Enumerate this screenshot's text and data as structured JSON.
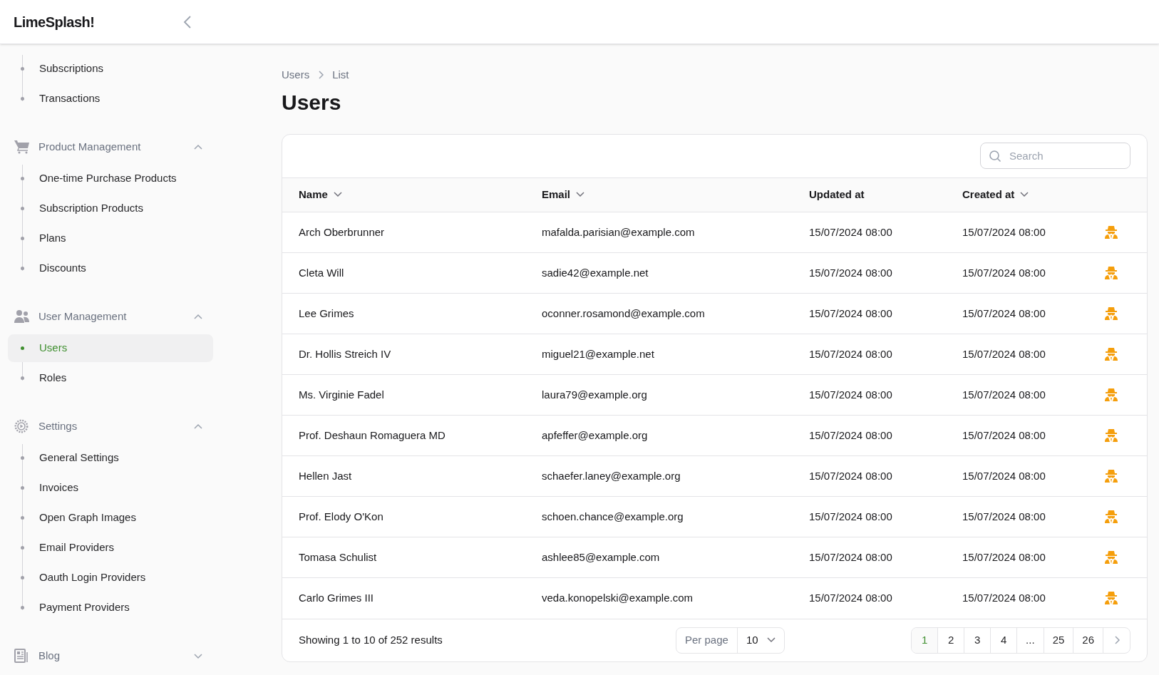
{
  "app": {
    "title": "LimeSplash!"
  },
  "sidebar": {
    "groups": [
      {
        "items": [
          {
            "label": "Subscriptions",
            "selected": false
          },
          {
            "label": "Transactions",
            "selected": false
          }
        ]
      },
      {
        "label": "Product Management",
        "kind": "cart",
        "expanded": true,
        "items": [
          {
            "label": "One-time Purchase Products",
            "selected": false
          },
          {
            "label": "Subscription Products",
            "selected": false
          },
          {
            "label": "Plans",
            "selected": false
          },
          {
            "label": "Discounts",
            "selected": false
          }
        ]
      },
      {
        "label": "User Management",
        "kind": "users",
        "expanded": true,
        "items": [
          {
            "label": "Users",
            "selected": true
          },
          {
            "label": "Roles",
            "selected": false
          }
        ]
      },
      {
        "label": "Settings",
        "kind": "gear",
        "expanded": true,
        "items": [
          {
            "label": "General Settings",
            "selected": false
          },
          {
            "label": "Invoices",
            "selected": false
          },
          {
            "label": "Open Graph Images",
            "selected": false
          },
          {
            "label": "Email Providers",
            "selected": false
          },
          {
            "label": "Oauth Login Providers",
            "selected": false
          },
          {
            "label": "Payment Providers",
            "selected": false
          }
        ]
      },
      {
        "label": "Blog",
        "kind": "news",
        "expanded": false
      }
    ]
  },
  "breadcrumb": [
    "Users",
    "List"
  ],
  "page_title": "Users",
  "search": {
    "placeholder": "Search"
  },
  "table": {
    "columns": [
      {
        "label": "Name",
        "sortable": true
      },
      {
        "label": "Email",
        "sortable": true
      },
      {
        "label": "Updated at",
        "sortable": false
      },
      {
        "label": "Created at",
        "sortable": true
      }
    ],
    "rows": [
      [
        "Arch Oberbrunner",
        "mafalda.parisian@example.com",
        "15/07/2024 08:00",
        "15/07/2024 08:00"
      ],
      [
        "Cleta Will",
        "sadie42@example.net",
        "15/07/2024 08:00",
        "15/07/2024 08:00"
      ],
      [
        "Lee Grimes",
        "oconner.rosamond@example.com",
        "15/07/2024 08:00",
        "15/07/2024 08:00"
      ],
      [
        "Dr. Hollis Streich IV",
        "miguel21@example.net",
        "15/07/2024 08:00",
        "15/07/2024 08:00"
      ],
      [
        "Ms. Virginie Fadel",
        "laura79@example.org",
        "15/07/2024 08:00",
        "15/07/2024 08:00"
      ],
      [
        "Prof. Deshaun Romaguera MD",
        "apfeffer@example.org",
        "15/07/2024 08:00",
        "15/07/2024 08:00"
      ],
      [
        "Hellen Jast",
        "schaefer.laney@example.org",
        "15/07/2024 08:00",
        "15/07/2024 08:00"
      ],
      [
        "Prof. Elody O'Kon",
        "schoen.chance@example.org",
        "15/07/2024 08:00",
        "15/07/2024 08:00"
      ],
      [
        "Tomasa Schulist",
        "ashlee85@example.com",
        "15/07/2024 08:00",
        "15/07/2024 08:00"
      ],
      [
        "Carlo Grimes III",
        "veda.konopelski@example.com",
        "15/07/2024 08:00",
        "15/07/2024 08:00"
      ]
    ]
  },
  "footer": {
    "summary": "Showing 1 to 10 of 252 results",
    "per_page_label": "Per page",
    "per_page_value": "10",
    "pages": [
      {
        "label": "1",
        "selected": true
      },
      {
        "label": "2",
        "selected": false
      },
      {
        "label": "3",
        "selected": false
      },
      {
        "label": "4",
        "selected": false
      },
      {
        "label": "...",
        "selected": false
      },
      {
        "label": "25",
        "selected": false
      },
      {
        "label": "26",
        "selected": false
      }
    ]
  }
}
